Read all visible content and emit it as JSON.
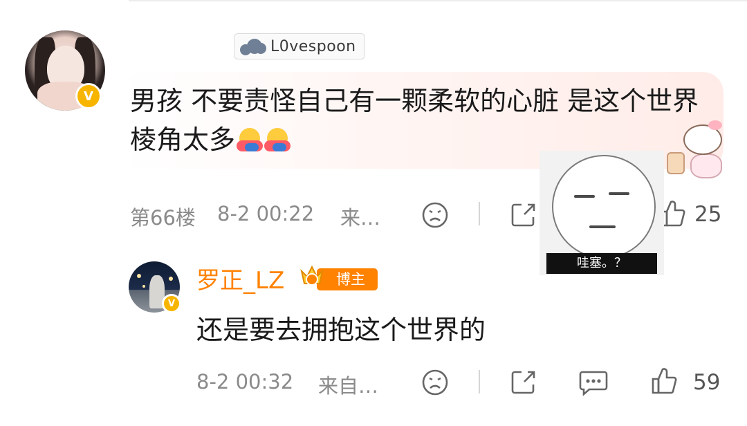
{
  "comment": {
    "username": "L0vespoon",
    "text": "男孩 不要责怪自己有一颗柔软的心脏 是这个世界棱角太多",
    "floor_label": "第66楼",
    "time": "8-2 00:22",
    "source": "来…",
    "like_count": "25"
  },
  "meme": {
    "caption": "哇塞。？"
  },
  "reply": {
    "username": "罗正_LZ",
    "badge_label": "博主",
    "text": "还是要去拥抱这个世界的",
    "time": "8-2 00:32",
    "source": "来自…",
    "like_count": "59"
  },
  "colors": {
    "accent": "#ff8200",
    "verified": "#f7b500",
    "meta_text": "#8a8a8a",
    "bubble": "#ffece8"
  },
  "icons": {
    "verified": "verified-badge-icon",
    "dislike": "sad-face-icon",
    "share": "share-icon",
    "comment": "comment-bubble-icon",
    "like": "thumbs-up-icon",
    "emoji": "hug-emoji-icon",
    "crown": "crown-icon"
  }
}
